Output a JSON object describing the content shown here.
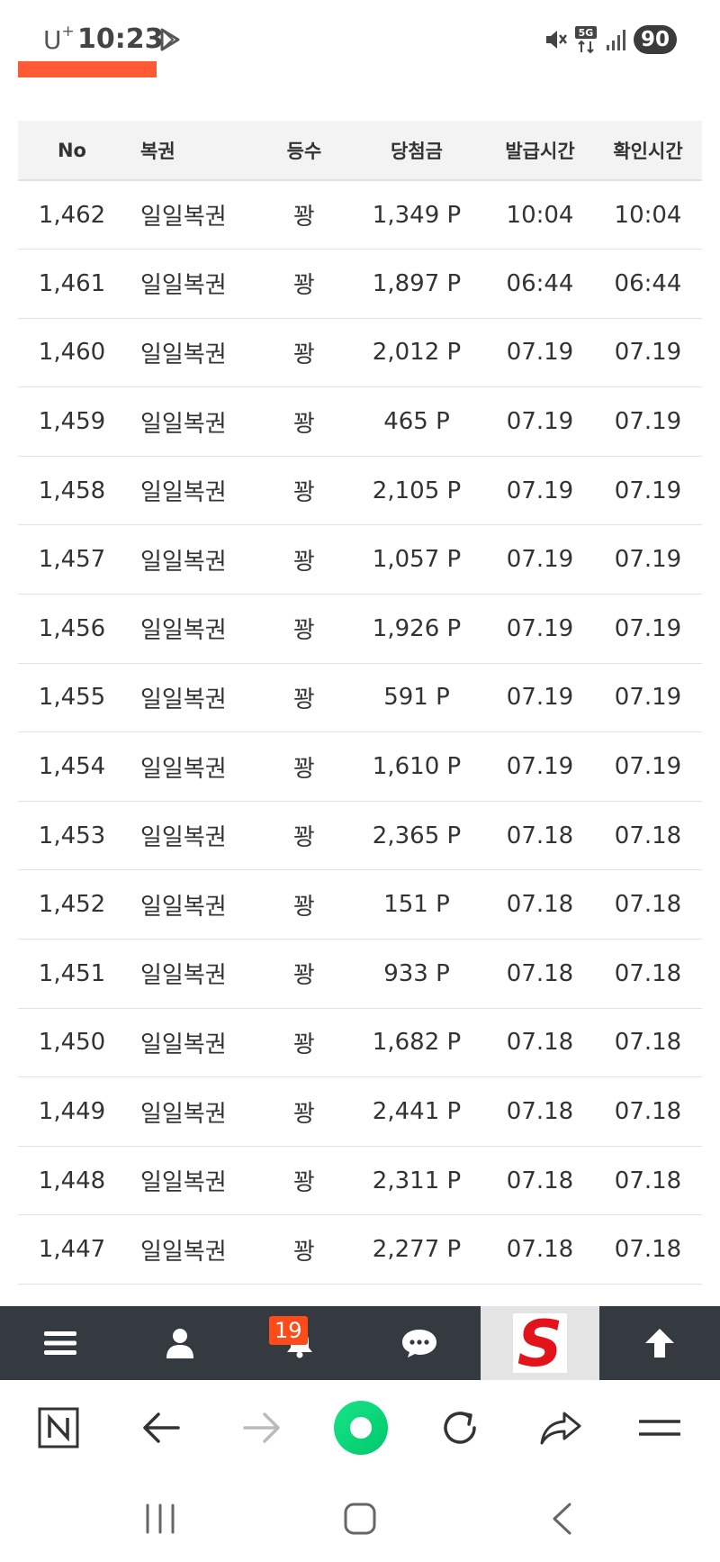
{
  "status_bar": {
    "carrier": "U",
    "carrier_sup": "+",
    "time": "10:23",
    "battery": "90",
    "network_label": "5G"
  },
  "table": {
    "headers": [
      "No",
      "복권",
      "등수",
      "당첨금",
      "발급시간",
      "확인시간"
    ],
    "rows": [
      [
        "1,462",
        "일일복권",
        "꽝",
        "1,349 P",
        "10:04",
        "10:04"
      ],
      [
        "1,461",
        "일일복권",
        "꽝",
        "1,897 P",
        "06:44",
        "06:44"
      ],
      [
        "1,460",
        "일일복권",
        "꽝",
        "2,012 P",
        "07.19",
        "07.19"
      ],
      [
        "1,459",
        "일일복권",
        "꽝",
        "465 P",
        "07.19",
        "07.19"
      ],
      [
        "1,458",
        "일일복권",
        "꽝",
        "2,105 P",
        "07.19",
        "07.19"
      ],
      [
        "1,457",
        "일일복권",
        "꽝",
        "1,057 P",
        "07.19",
        "07.19"
      ],
      [
        "1,456",
        "일일복권",
        "꽝",
        "1,926 P",
        "07.19",
        "07.19"
      ],
      [
        "1,455",
        "일일복권",
        "꽝",
        "591 P",
        "07.19",
        "07.19"
      ],
      [
        "1,454",
        "일일복권",
        "꽝",
        "1,610 P",
        "07.19",
        "07.19"
      ],
      [
        "1,453",
        "일일복권",
        "꽝",
        "2,365 P",
        "07.18",
        "07.18"
      ],
      [
        "1,452",
        "일일복권",
        "꽝",
        "151 P",
        "07.18",
        "07.18"
      ],
      [
        "1,451",
        "일일복권",
        "꽝",
        "933 P",
        "07.18",
        "07.18"
      ],
      [
        "1,450",
        "일일복권",
        "꽝",
        "1,682 P",
        "07.18",
        "07.18"
      ],
      [
        "1,449",
        "일일복권",
        "꽝",
        "2,441 P",
        "07.18",
        "07.18"
      ],
      [
        "1,448",
        "일일복권",
        "꽝",
        "2,311 P",
        "07.18",
        "07.18"
      ],
      [
        "1,447",
        "일일복권",
        "꽝",
        "2,277 P",
        "07.18",
        "07.18"
      ]
    ]
  },
  "site_toolbar": {
    "notification_count": "19",
    "logo_letter": "S",
    "icons": [
      "menu-icon",
      "user-icon",
      "bell-icon",
      "chat-icon",
      "site-logo",
      "arrow-up-icon"
    ]
  },
  "browser_bar": {
    "icons": [
      "naver-n-icon",
      "back-arrow-icon",
      "forward-arrow-icon",
      "green-dot-home-icon",
      "reload-icon",
      "share-icon",
      "browser-menu-icon"
    ]
  },
  "colors": {
    "accent_orange": "#ff5a36",
    "toolbar_bg": "#343a40",
    "badge": "#ff4a1a",
    "green_button": "#1ee07f",
    "logo_red": "#e3121b"
  }
}
